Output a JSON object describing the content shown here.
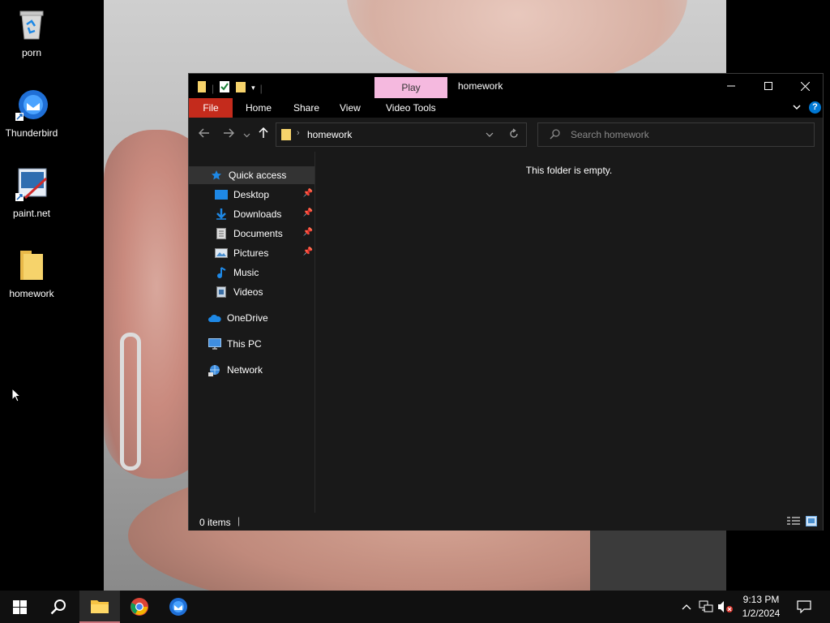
{
  "desktop": {
    "icons": [
      {
        "label": "porn"
      },
      {
        "label": "Thunderbird"
      },
      {
        "label": "paint.net"
      },
      {
        "label": "homework"
      }
    ]
  },
  "window": {
    "title": "homework",
    "contextual_tab": "Play",
    "ribbon_tabs": [
      "File",
      "Home",
      "Share",
      "View",
      "Video Tools"
    ],
    "address_segment": "homework",
    "search_placeholder": "Search homework",
    "empty_message": "This folder is empty.",
    "status_items": "0 items",
    "help_label": "?"
  },
  "navpane": {
    "quick_access": "Quick access",
    "items": [
      {
        "label": "Desktop",
        "pinned": true
      },
      {
        "label": "Downloads",
        "pinned": true
      },
      {
        "label": "Documents",
        "pinned": true
      },
      {
        "label": "Pictures",
        "pinned": true
      },
      {
        "label": "Music",
        "pinned": false
      },
      {
        "label": "Videos",
        "pinned": false
      }
    ],
    "onedrive": "OneDrive",
    "this_pc": "This PC",
    "network": "Network"
  },
  "taskbar": {
    "time": "9:13 PM",
    "date": "1/2/2024"
  },
  "colors": {
    "file_tab": "#c42b1c",
    "play_tab": "#f5b9df",
    "folder": "#f2c94c",
    "accent_blue": "#0078d4"
  }
}
